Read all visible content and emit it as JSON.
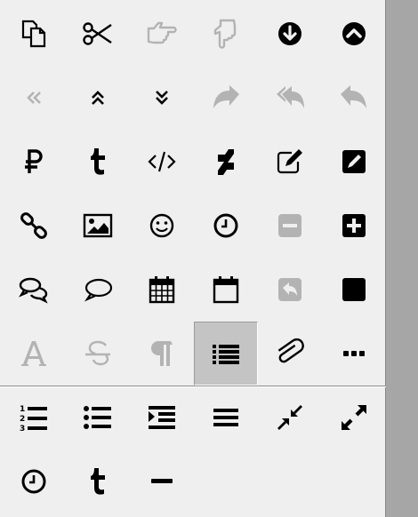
{
  "toolbar": {
    "icons": [
      {
        "name": "copy-icon",
        "enabled": true
      },
      {
        "name": "scissors-icon",
        "enabled": true
      },
      {
        "name": "hand-point-right-icon",
        "enabled": false
      },
      {
        "name": "hand-point-down-icon",
        "enabled": false
      },
      {
        "name": "arrow-circle-down-icon",
        "enabled": true
      },
      {
        "name": "chevron-circle-up-icon",
        "enabled": true
      },
      {
        "name": "double-angle-left-icon",
        "enabled": false
      },
      {
        "name": "double-angle-up-icon",
        "enabled": true
      },
      {
        "name": "double-angle-down-icon",
        "enabled": true
      },
      {
        "name": "share-icon",
        "enabled": false
      },
      {
        "name": "reply-all-icon",
        "enabled": false
      },
      {
        "name": "reply-icon",
        "enabled": false
      },
      {
        "name": "ruble-icon",
        "enabled": true
      },
      {
        "name": "tumblr-icon",
        "enabled": true
      },
      {
        "name": "code-icon",
        "enabled": true
      },
      {
        "name": "deviantart-icon",
        "enabled": true
      },
      {
        "name": "edit-icon",
        "enabled": true
      },
      {
        "name": "pencil-square-icon",
        "enabled": true
      },
      {
        "name": "chain-link-icon",
        "enabled": true
      },
      {
        "name": "image-icon",
        "enabled": true
      },
      {
        "name": "smile-icon",
        "enabled": true
      },
      {
        "name": "clock-icon",
        "enabled": true
      },
      {
        "name": "minus-square-icon",
        "enabled": false
      },
      {
        "name": "plus-square-icon",
        "enabled": true
      },
      {
        "name": "comments-icon",
        "enabled": true
      },
      {
        "name": "comment-icon",
        "enabled": true
      },
      {
        "name": "calendar-icon",
        "enabled": true
      },
      {
        "name": "calendar-blank-icon",
        "enabled": true
      },
      {
        "name": "reply-square-icon",
        "enabled": false
      },
      {
        "name": "square-icon",
        "enabled": true
      },
      {
        "name": "font-icon",
        "enabled": false
      },
      {
        "name": "strikethrough-icon",
        "enabled": false
      },
      {
        "name": "paragraph-icon",
        "enabled": false
      },
      {
        "name": "list-icon",
        "enabled": true,
        "selected": true
      },
      {
        "name": "paperclip-icon",
        "enabled": true
      },
      {
        "name": "ellipsis-icon",
        "enabled": true
      },
      {
        "name": "ordered-list-icon",
        "enabled": true
      },
      {
        "name": "unordered-list-icon",
        "enabled": true
      },
      {
        "name": "indent-icon",
        "enabled": true
      },
      {
        "name": "align-justify-icon",
        "enabled": true
      },
      {
        "name": "compress-icon",
        "enabled": true
      },
      {
        "name": "expand-icon",
        "enabled": true
      },
      {
        "name": "clock-icon",
        "enabled": true
      },
      {
        "name": "tumblr-icon",
        "enabled": true
      },
      {
        "name": "minus-icon",
        "enabled": true
      }
    ],
    "colors": {
      "enabled": "#000000",
      "disabled": "#b3b3b3",
      "panel": "#efefef",
      "selected": "#c4c4c4"
    }
  }
}
